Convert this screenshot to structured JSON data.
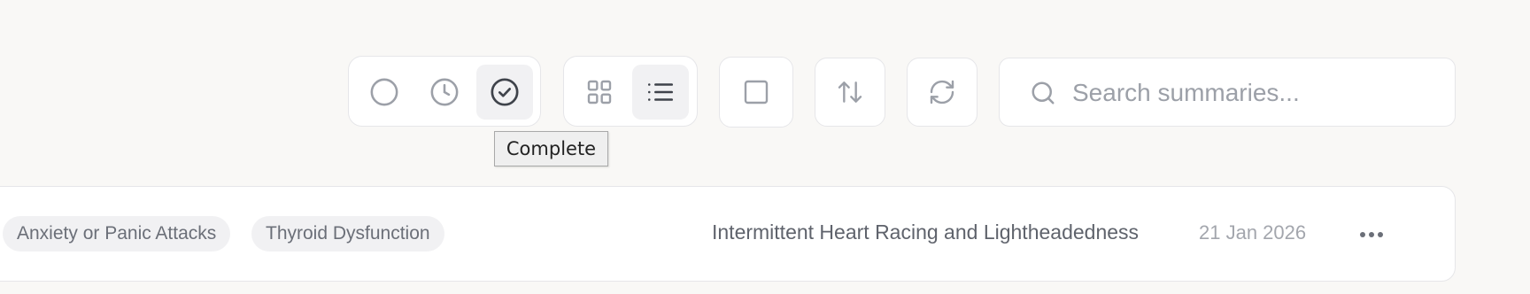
{
  "toolbar": {
    "status_filters": [
      {
        "name": "not-started",
        "icon": "circle-icon",
        "active": false
      },
      {
        "name": "in-progress",
        "icon": "clock-icon",
        "active": false
      },
      {
        "name": "complete",
        "icon": "check-circle-icon",
        "active": true
      }
    ],
    "view_modes": [
      {
        "name": "grid",
        "icon": "grid-icon",
        "active": false
      },
      {
        "name": "list",
        "icon": "list-icon",
        "active": true
      }
    ],
    "select_icon": "checkbox-icon",
    "sort_icon": "sort-arrows-icon",
    "refresh_icon": "refresh-icon",
    "tooltip": "Complete"
  },
  "search": {
    "placeholder": "Search summaries...",
    "value": "",
    "icon": "search-icon"
  },
  "summaries": [
    {
      "tags": [
        "Anxiety or Panic Attacks",
        "Thyroid Dysfunction"
      ],
      "title": "Intermittent Heart Racing and Lightheadedness",
      "date": "21 Jan 2026",
      "menu_icon": "more-horizontal-icon"
    }
  ],
  "colors": {
    "background": "#f9f8f6",
    "card": "#ffffff",
    "border": "#e6e6e9",
    "icon": "#9ca0a8",
    "icon_active": "#3f434b",
    "active_bg": "#f1f1f3"
  }
}
